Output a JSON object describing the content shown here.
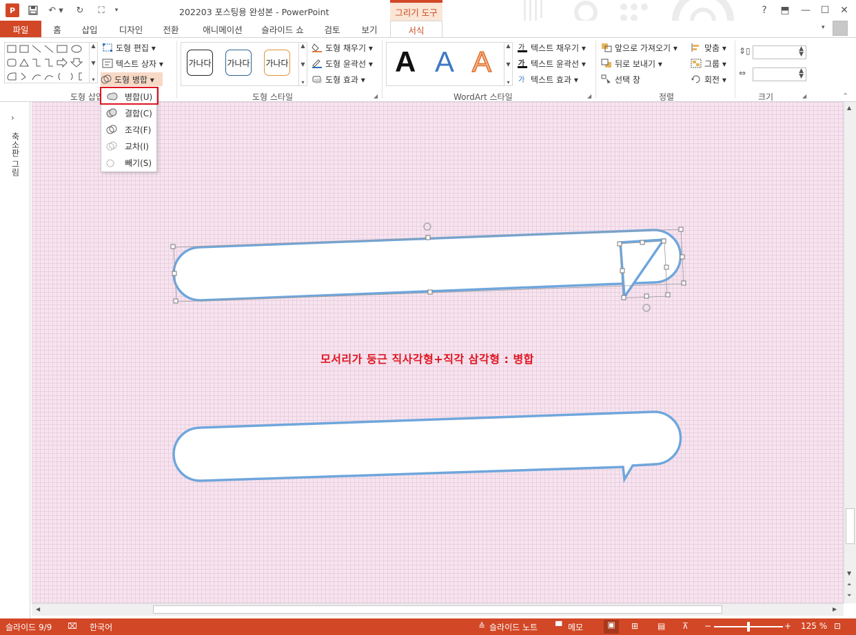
{
  "app": {
    "title": "202203 포스팅용 완성본 - PowerPoint",
    "app_icon": "P",
    "contextual_tab": "그리기 도구"
  },
  "qat": {
    "save_icon": "save-icon",
    "undo_label": "↶ ▾",
    "redo_label": "↻",
    "present_label": "⛶",
    "more_label": "▾"
  },
  "window": {
    "help": "?",
    "restore_ribbon": "⬒",
    "minimize": "—",
    "maximize": "☐",
    "close": "✕"
  },
  "tabs": [
    {
      "label": "파일"
    },
    {
      "label": "홈"
    },
    {
      "label": "삽입"
    },
    {
      "label": "디자인"
    },
    {
      "label": "전환"
    },
    {
      "label": "애니메이션"
    },
    {
      "label": "슬라이드 쇼"
    },
    {
      "label": "검토"
    },
    {
      "label": "보기"
    },
    {
      "label": "서식"
    }
  ],
  "ribbon": {
    "insert_shapes": {
      "label": "도형 삽입",
      "edit_shape": "도형 편집 ▾",
      "text_box": "텍스트 상자 ▾",
      "merge_shapes": "도형 병합 ▾"
    },
    "shape_styles": {
      "label": "도형 스타일",
      "swatches": [
        "가나다",
        "가나다",
        "가나다"
      ],
      "fill": "도형 채우기 ▾",
      "outline": "도형 윤곽선 ▾",
      "effects": "도형 효과 ▾"
    },
    "wordart": {
      "label": "WordArt 스타일",
      "letters": [
        "A",
        "A",
        "A"
      ],
      "text_fill": "텍스트 채우기 ▾",
      "text_outline": "텍스트 윤곽선 ▾",
      "text_effects": "텍스트 효과 ▾"
    },
    "arrange": {
      "label": "정렬",
      "bring_forward": "앞으로 가져오기 ▾",
      "send_backward": "뒤로 보내기 ▾",
      "selection_pane": "선택 창",
      "align": "맞춤 ▾",
      "group": "그룹 ▾",
      "rotate": "회전 ▾"
    },
    "size": {
      "label": "크기"
    }
  },
  "merge_menu": {
    "items": [
      {
        "label": "병합(U)"
      },
      {
        "label": "결합(C)"
      },
      {
        "label": "조각(F)"
      },
      {
        "label": "교차(I)"
      },
      {
        "label": "빼기(S)"
      }
    ]
  },
  "slide_pane": {
    "label": "축소판 그림",
    "expand": "›"
  },
  "slide": {
    "caption": "모서리가 둥근 직사각형+직각 삼각형 : 병합",
    "shape_color": "#6fa6dc",
    "caption_color": "#e0141f"
  },
  "status": {
    "slide_info": "슬라이드 9/9",
    "language": "한국어",
    "notes": "슬라이드 노트",
    "comments": "메모",
    "zoom": "125 %"
  }
}
